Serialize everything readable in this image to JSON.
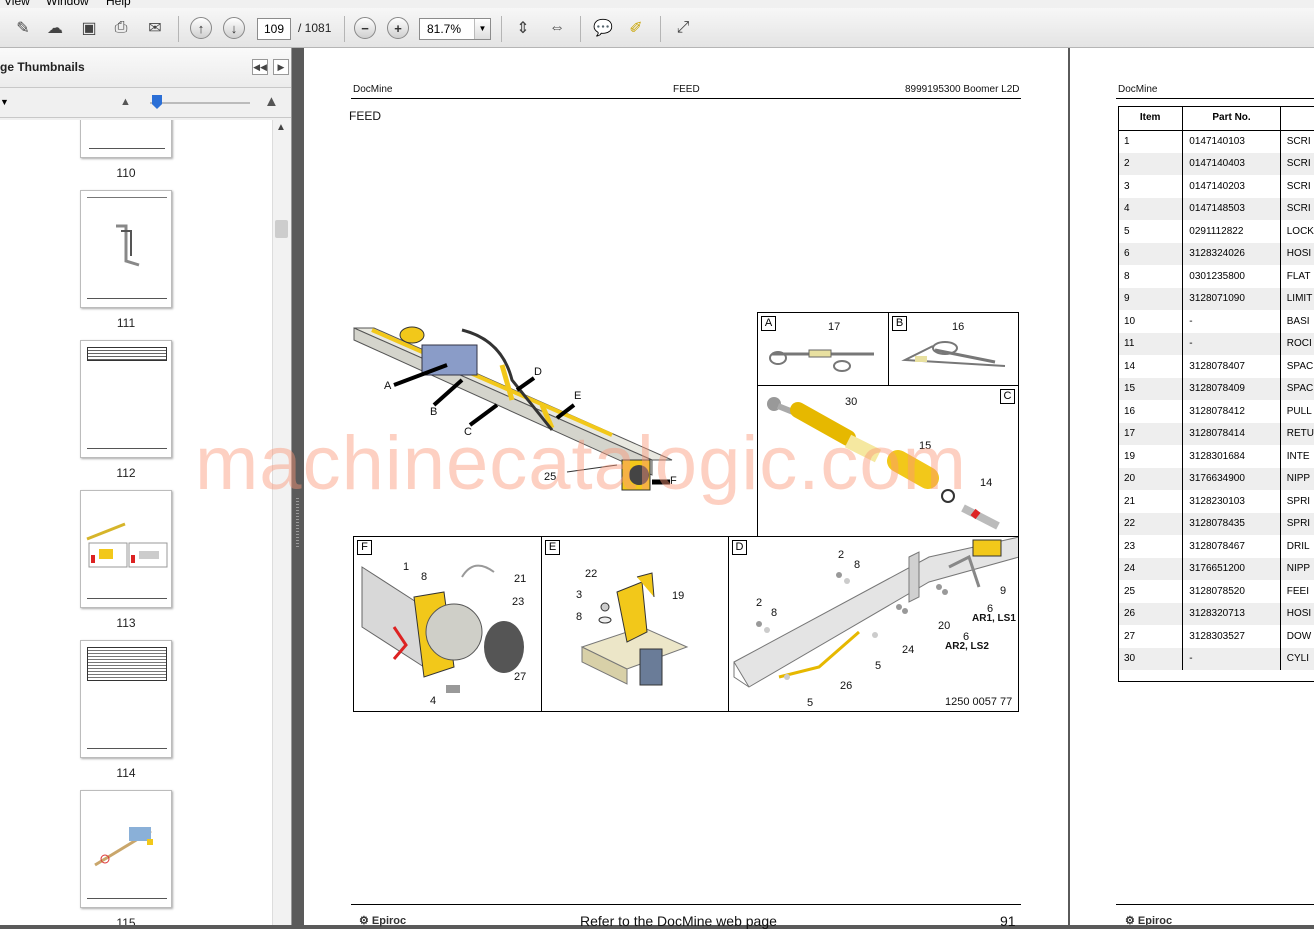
{
  "menu": {
    "items": [
      "View",
      "Window",
      "Help"
    ]
  },
  "toolbar": {
    "current_page": "109",
    "total_pages": "/ 1081",
    "zoom": "81.7%",
    "icons": [
      "edit-icon",
      "upload-icon",
      "save-icon",
      "print-icon",
      "email-icon",
      "prev-page-icon",
      "next-page-icon",
      "zoom-out-icon",
      "zoom-in-icon",
      "fit-page-icon",
      "fit-width-icon",
      "comment-icon",
      "highlight-icon",
      "fullscreen-icon"
    ]
  },
  "sidebar": {
    "title": "ge Thumbnails",
    "thumbnails": [
      {
        "label": "110"
      },
      {
        "label": "111"
      },
      {
        "label": "112"
      },
      {
        "label": "113"
      },
      {
        "label": "114"
      },
      {
        "label": "115"
      }
    ]
  },
  "page1": {
    "header_left": "DocMine",
    "header_center": "FEED",
    "header_right": "8999195300 Boomer L2D",
    "section_title": "FEED",
    "figure_number": "1250 0057 77",
    "footer_text": "Refer to the DocMine web page",
    "footer_page": "91",
    "callouts_main": [
      "A",
      "B",
      "C",
      "D",
      "E",
      "25",
      "F"
    ],
    "box_a": {
      "letter": "A",
      "num": "17"
    },
    "box_b": {
      "letter": "B",
      "num": "16"
    },
    "box_c": {
      "letter": "C",
      "nums": [
        "30",
        "15",
        "14"
      ]
    },
    "box_f": {
      "letter": "F",
      "nums": [
        "1",
        "8",
        "21",
        "23",
        "27",
        "4"
      ]
    },
    "box_e": {
      "letter": "E",
      "nums": [
        "22",
        "19",
        "3",
        "8"
      ]
    },
    "box_d": {
      "letter": "D",
      "nums": [
        "2",
        "8",
        "2",
        "8",
        "9",
        "6",
        "AR1, LS1",
        "6",
        "AR2, LS2",
        "20",
        "24",
        "5",
        "26",
        "5"
      ]
    }
  },
  "page2": {
    "header_left": "DocMine",
    "columns": [
      "Item",
      "Part No."
    ],
    "rows": [
      [
        "1",
        "0147140103",
        "SCRI"
      ],
      [
        "2",
        "0147140403",
        "SCRI"
      ],
      [
        "3",
        "0147140203",
        "SCRI"
      ],
      [
        "4",
        "0147148503",
        "SCRI"
      ],
      [
        "5",
        "0291112822",
        "LOCK"
      ],
      [
        "6",
        "3128324026",
        "HOSI"
      ],
      [
        "8",
        "0301235800",
        "FLAT"
      ],
      [
        "9",
        "3128071090",
        "LIMIT"
      ],
      [
        "10",
        "-",
        "BASI"
      ],
      [
        "11",
        "-",
        "ROCI"
      ],
      [
        "14",
        "3128078407",
        "SPAC"
      ],
      [
        "15",
        "3128078409",
        "SPAC"
      ],
      [
        "16",
        "3128078412",
        "PULL"
      ],
      [
        "17",
        "3128078414",
        "RETU"
      ],
      [
        "19",
        "3128301684",
        "INTE"
      ],
      [
        "20",
        "3176634900",
        "NIPP"
      ],
      [
        "21",
        "3128230103",
        "SPRI"
      ],
      [
        "22",
        "3128078435",
        "SPRI"
      ],
      [
        "23",
        "3128078467",
        "DRIL"
      ],
      [
        "24",
        "3176651200",
        "NIPP"
      ],
      [
        "25",
        "3128078520",
        "FEEI"
      ],
      [
        "26",
        "3128320713",
        "HOSI"
      ],
      [
        "27",
        "3128303527",
        "DOW"
      ],
      [
        "30",
        "-",
        "CYLI"
      ]
    ]
  },
  "watermark": "machinecatalogic.com",
  "colors": {
    "accent_yellow": "#f2c81a",
    "slider_blue": "#2b6fd6",
    "watermark": "#fa9678"
  }
}
